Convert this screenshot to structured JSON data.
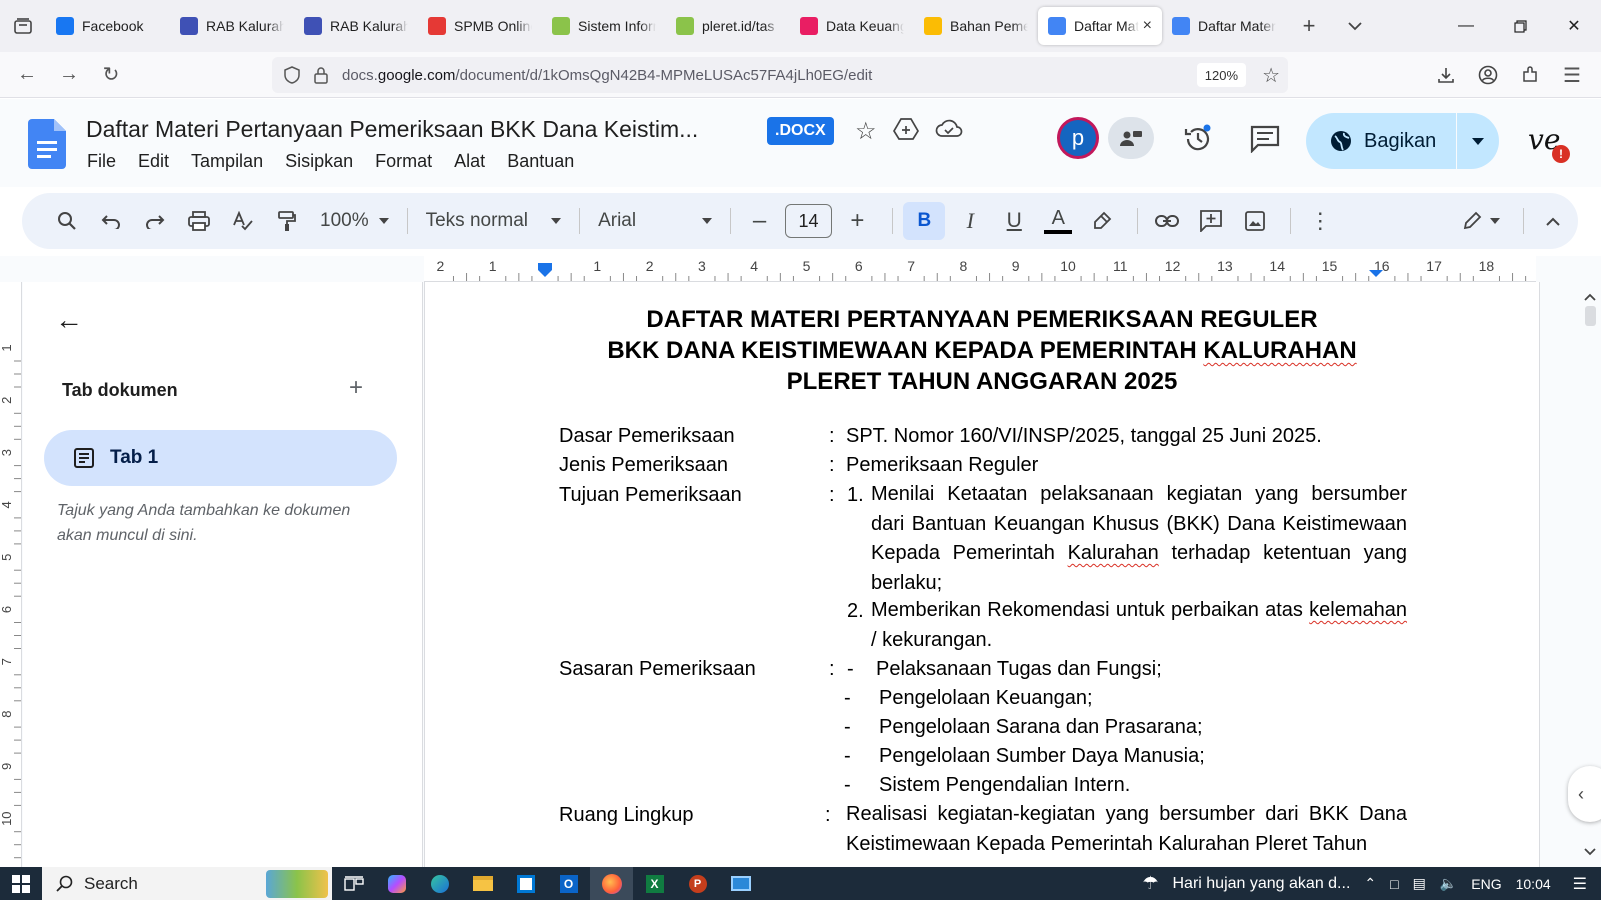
{
  "browser": {
    "tabs": [
      {
        "label": "Facebook",
        "icon": "facebook-icon",
        "color": "#1877f2"
      },
      {
        "label": "RAB Kalurahan",
        "icon": "rab-icon",
        "color": "#3f51b5"
      },
      {
        "label": "RAB Kalurahan",
        "icon": "rab-icon",
        "color": "#3f51b5"
      },
      {
        "label": "SPMB Online",
        "icon": "spmb-icon",
        "color": "#e53935"
      },
      {
        "label": "Sistem Informasi",
        "icon": "seal-icon",
        "color": "#8bc34a"
      },
      {
        "label": "pleret.id/tas",
        "icon": "seal-icon",
        "color": "#8bc34a"
      },
      {
        "label": "Data Keuangan",
        "icon": "flower-icon",
        "color": "#e91e63"
      },
      {
        "label": "Bahan Pemeriksaan",
        "icon": "drive-icon",
        "color": "#fbbc04"
      },
      {
        "label": "Daftar Materi",
        "icon": "docs-icon",
        "color": "#4285f4",
        "active": true
      },
      {
        "label": "Daftar Materi",
        "icon": "docs-icon",
        "color": "#4285f4"
      }
    ],
    "url_prefix": "docs.",
    "url_host": "google.com",
    "url_path": "/document/d/1kOmsQgN42B4-MPMeLUSAc57FA4jLh0EG/edit",
    "zoom": "120%"
  },
  "doc": {
    "title": "Daftar Materi Pertanyaan Pemeriksaan BKK Dana Keistim...",
    "format_badge": ".DOCX",
    "menus": [
      "File",
      "Edit",
      "Tampilan",
      "Sisipkan",
      "Format",
      "Alat",
      "Bantuan"
    ],
    "avatar_letter": "p",
    "share_label": "Bagikan"
  },
  "toolbar": {
    "zoom": "100%",
    "style": "Teks normal",
    "font": "Arial",
    "font_size": "14"
  },
  "ruler": {
    "ticks": [
      "2",
      "1",
      "",
      "1",
      "2",
      "3",
      "4",
      "5",
      "6",
      "7",
      "8",
      "9",
      "10",
      "11",
      "12",
      "13",
      "14",
      "15",
      "16",
      "17",
      "18"
    ],
    "vticks": [
      "1",
      "2",
      "3",
      "4",
      "5",
      "6",
      "7",
      "8",
      "9",
      "10"
    ]
  },
  "sidebar": {
    "heading": "Tab dokumen",
    "tab_label": "Tab 1",
    "hint": "Tajuk yang Anda tambahkan ke dokumen akan muncul di sini."
  },
  "content": {
    "heading_line1": "DAFTAR  MATERI  PERTANYAAN PEMERIKSAAN REGULER",
    "heading_line2a": "BKK DANA KEISTIMEWAAN KEPADA PEMERINTAH ",
    "heading_line2b": "KALURAHAN",
    "heading_line3": "PLERET TAHUN ANGGARAN  2025",
    "rows": [
      {
        "label": "Dasar Pemeriksaan",
        "value": "SPT. Nomor 160/VI/INSP/2025, tanggal 25 Juni 2025."
      },
      {
        "label": "Jenis Pemeriksaan",
        "value": "Pemeriksaan Reguler"
      },
      {
        "label": "Tujuan Pemeriksaan"
      },
      {
        "label": "Sasaran Pemeriksaan"
      },
      {
        "label": "Ruang Lingkup"
      }
    ],
    "colon": ":",
    "tujuan_1_num": "1.",
    "tujuan_1a": "Menilai Ketaatan pelaksanaan kegiatan yang bersumber dari Bantuan Keuangan Khusus (BKK) Dana Keistimewaan Kepada Pemerintah ",
    "tujuan_1b": "Kalurahan",
    "tujuan_1c": " terhadap ketentuan yang berlaku;",
    "tujuan_2_num": "2.",
    "tujuan_2a": "Memberikan Rekomendasi untuk perbaikan atas ",
    "tujuan_2b": "kelemahan",
    "tujuan_2c": " / kekurangan.",
    "sasaran": [
      "Pelaksanaan Tugas dan Fungsi;",
      "Pengelolaan Keuangan;",
      "Pengelolaan Sarana dan Prasarana;",
      "Pengelolaan Sumber Daya Manusia;",
      "Sistem Pengendalian Intern."
    ],
    "dash": "-",
    "ruang_lingkup": "Realisasi kegiatan-kegiatan yang bersumber dari BKK Dana Keistimewaan Kepada Pemerintah Kalurahan Pleret Tahun"
  },
  "taskbar": {
    "search": "Search",
    "weather": "Hari hujan yang akan d...",
    "lang": "ENG",
    "time": "10:04"
  }
}
